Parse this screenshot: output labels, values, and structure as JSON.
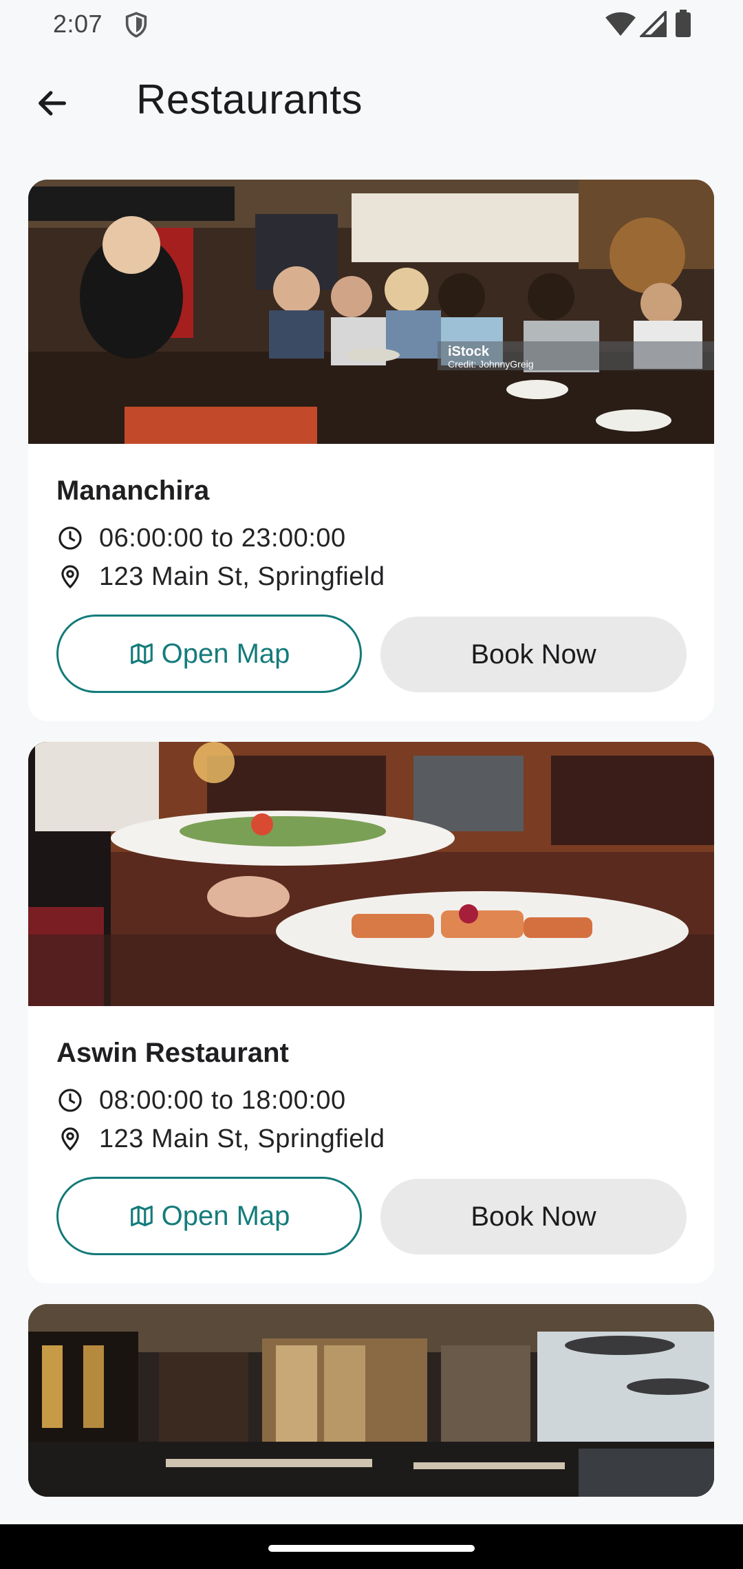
{
  "status_bar": {
    "time": "2:07",
    "icons": [
      "shield-icon",
      "wifi-icon",
      "signal-icon",
      "battery-icon"
    ]
  },
  "app_bar": {
    "title": "Restaurants",
    "back_icon": "arrow-left-icon"
  },
  "restaurants": [
    {
      "name": "Mananchira",
      "hours": "06:00:00 to 23:00:00",
      "address": "123 Main St, Springfield",
      "open_map_label": "Open Map",
      "book_label": "Book Now",
      "image_watermark": "iStock",
      "image_credit": "Credit: JohnnyGreig"
    },
    {
      "name": "Aswin Restaurant",
      "hours": "08:00:00 to 18:00:00",
      "address": "123 Main St, Springfield",
      "open_map_label": "Open Map",
      "book_label": "Book Now"
    },
    {}
  ],
  "colors": {
    "accent": "#137a7a",
    "background": "#f6f8f9",
    "card": "#ffffff",
    "book_button": "#e9e9ea"
  }
}
